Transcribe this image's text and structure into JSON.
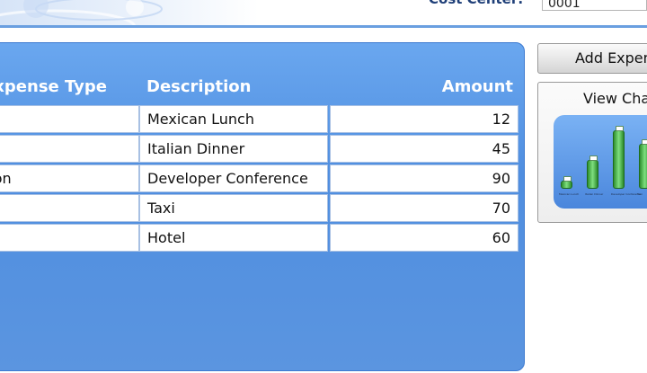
{
  "header": {
    "cost_center_label": "Cost Center:",
    "cost_center_value": "0001"
  },
  "grid": {
    "columns": [
      "Expense Type",
      "Description",
      "Amount"
    ],
    "rows": [
      {
        "type": "",
        "description": "Mexican Lunch",
        "amount": "12"
      },
      {
        "type": "",
        "description": "Italian Dinner",
        "amount": "45"
      },
      {
        "type": "tion",
        "description": "Developer Conference",
        "amount": "90"
      },
      {
        "type": "",
        "description": "Taxi",
        "amount": "70"
      },
      {
        "type": "",
        "description": "Hotel",
        "amount": "60"
      }
    ]
  },
  "actions": {
    "add_label": "Add Expense",
    "chart_label": "View Chart"
  },
  "chart_data": {
    "type": "bar",
    "categories": [
      "Mexican Lunch",
      "Italian Dinner",
      "Developer Conference",
      "Taxi"
    ],
    "values": [
      12,
      45,
      90,
      70
    ],
    "ylim": [
      0,
      100
    ]
  },
  "colors": {
    "panel_blue": "#5b95e0",
    "accent_line": "#6a9fe0",
    "bar_green": "#3ea03e"
  }
}
